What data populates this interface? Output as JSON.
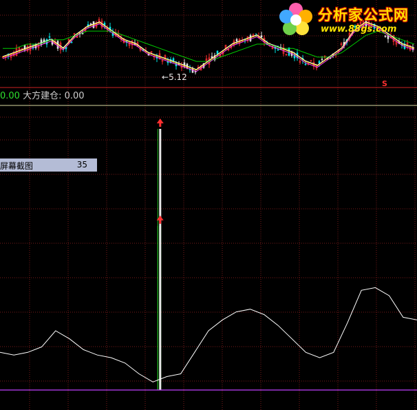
{
  "watermark": {
    "name": "分析家公式网",
    "url": "www.88gs.com"
  },
  "price_panel": {
    "low_marker": "5.12",
    "signal_mark": "S"
  },
  "indicator_readout": {
    "value1": "0.00",
    "label2": "大方建仓:",
    "value2": "0.00"
  },
  "tooltip": {
    "label": "屏幕截图",
    "value": "35"
  },
  "colors": {
    "background": "#000000",
    "grid": "#7a1a1a",
    "price_up": "#ff3030",
    "price_down": "#00e5e5",
    "ma_white": "#ffffff",
    "ma_yellow": "#ffd000",
    "ma_magenta": "#ff40ff",
    "ma_green": "#00cc00",
    "indicator_line": "#ffffff",
    "baseline": "#c040ff",
    "signal_green": "#20c020",
    "arrow_red": "#ff3030",
    "separator": "#cc2222"
  },
  "icons": {
    "signal_arrow": "up-arrow-icon",
    "logo": "flower-icon"
  },
  "chart_data": [
    {
      "type": "line",
      "series": [
        {
          "values": [
            0.98,
            0.99,
            1.0,
            1.01,
            1.02,
            1.0,
            1.03,
            1.05,
            1.06,
            1.04,
            1.02,
            1.01,
            0.99,
            0.98,
            0.97,
            0.96,
            0.95,
            0.97,
            0.99,
            1.01,
            1.02,
            1.03,
            1.01,
            1.0,
            0.99,
            0.97,
            0.96,
            0.98,
            1.0,
            1.04,
            1.06,
            1.05,
            1.03,
            1.01,
            1.0
          ]
        },
        {
          "values": [
            1.0,
            1.0,
            1.01,
            1.01,
            1.02,
            1.02,
            1.03,
            1.04,
            1.04,
            1.04,
            1.03,
            1.02,
            1.01,
            1.0,
            0.99,
            0.98,
            0.97,
            0.97,
            0.98,
            0.99,
            1.0,
            1.01,
            1.01,
            1.0,
            1.0,
            0.99,
            0.98,
            0.98,
            0.99,
            1.01,
            1.03,
            1.04,
            1.03,
            1.02,
            1.01
          ]
        }
      ]
    },
    {
      "type": "line",
      "series": [
        {
          "values": [
            14,
            13,
            14,
            16,
            22,
            19,
            15,
            13,
            12,
            10,
            6,
            3,
            5,
            6,
            14,
            22,
            26,
            29,
            30,
            28,
            24,
            19,
            14,
            12,
            14,
            25,
            37,
            38,
            35,
            27,
            26
          ]
        }
      ],
      "signals": [
        {
          "index": 11,
          "value": 64
        },
        {
          "index": 11.5,
          "value": 100
        }
      ]
    }
  ]
}
